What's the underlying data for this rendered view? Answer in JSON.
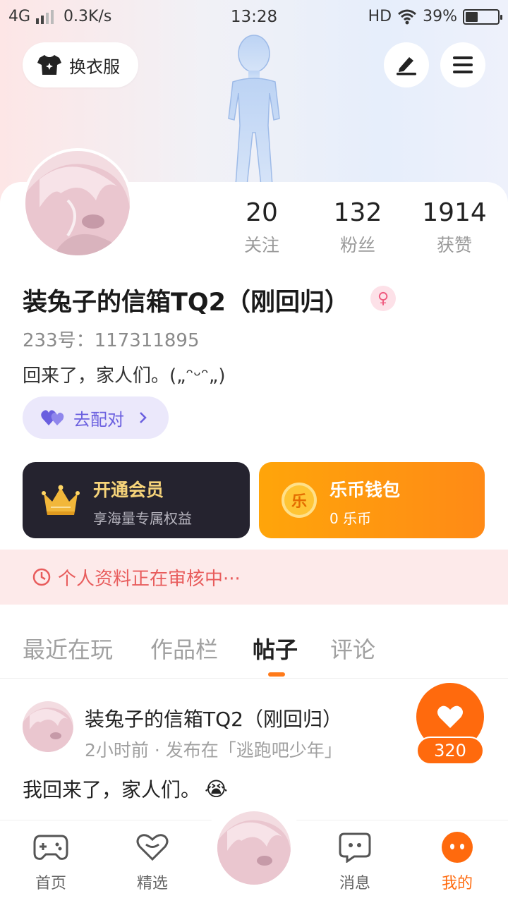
{
  "status_bar": {
    "network": "4G",
    "speed": "0.3K/s",
    "time": "13:28",
    "hd": "HD",
    "battery_percent": "39%",
    "battery_level": 0.39
  },
  "header": {
    "outfit_label": "换衣服"
  },
  "profile": {
    "stats": [
      {
        "value": "20",
        "label": "关注"
      },
      {
        "value": "132",
        "label": "粉丝"
      },
      {
        "value": "1914",
        "label": "获赞"
      }
    ],
    "name": "装兔子的信箱TQ2（刚回归）",
    "gender_symbol": "♀",
    "uid": "233号：117311895",
    "bio": "回来了，家人们。(„ᵔᵕᵔ„)",
    "match_label": "去配对"
  },
  "cards": {
    "vip": {
      "title": "开通会员",
      "subtitle": "享海量专属权益"
    },
    "wallet": {
      "title": "乐币钱包",
      "subtitle": "0 乐币",
      "coin_glyph": "乐"
    }
  },
  "review_notice": "个人资料正在审核中···",
  "tabs": [
    {
      "label": "最近在玩"
    },
    {
      "label": "作品栏"
    },
    {
      "label": "帖子"
    },
    {
      "label": "评论"
    }
  ],
  "post": {
    "author": "装兔子的信箱TQ2（刚回归）",
    "meta": "2小时前 · 发布在「逃跑吧少年」",
    "text": "我回来了，家人们。",
    "emoji": "😭",
    "likes": "320"
  },
  "bottom_nav": [
    {
      "label": "首页"
    },
    {
      "label": "精选"
    },
    {
      "label": "消息"
    },
    {
      "label": "我的"
    }
  ],
  "colors": {
    "accent": "#ff6a0d",
    "vip_gold": "#f7d47a",
    "review_red": "#e85c5c",
    "match_purple": "#6a5fdf"
  }
}
